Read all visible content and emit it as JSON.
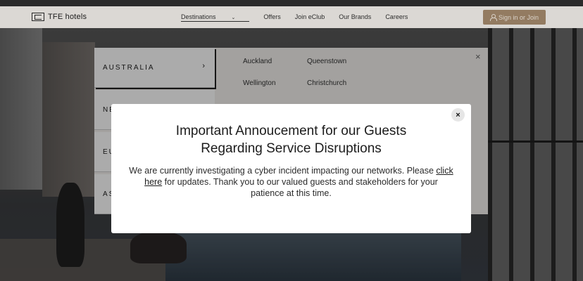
{
  "header": {
    "logo_text": "TFE hotels",
    "nav": [
      {
        "label": "Destinations",
        "active": true
      },
      {
        "label": "Offers"
      },
      {
        "label": "Join eClub"
      },
      {
        "label": "Our Brands"
      },
      {
        "label": "Careers"
      }
    ],
    "signin_label": "Sign in or Join"
  },
  "dropdown": {
    "regions": [
      "AUSTRALIA",
      "NE",
      "EU",
      "AS"
    ],
    "cities": [
      "Auckland",
      "Queenstown",
      "Wellington",
      "Christchurch"
    ],
    "close_icon": "×"
  },
  "modal": {
    "title_line1": "Important Annoucement for our Guests",
    "title_line2": "Regarding Service Disruptions",
    "body_before": "We are currently investigating a cyber incident impacting our networks. Please ",
    "link_text": "click here",
    "body_after": " for updates. Thank you to our valued guests and stakeholders for your patience at this time.",
    "close_icon": "×"
  },
  "colors": {
    "signin_bg": "#a48a6c",
    "header_bg": "#f4f1ec",
    "modal_bg": "#ffffff"
  }
}
